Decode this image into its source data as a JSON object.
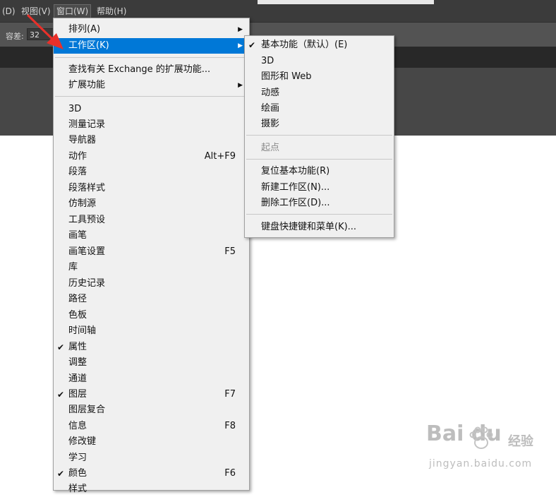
{
  "menubar": {
    "items": [
      {
        "label": "(D)",
        "active": false
      },
      {
        "label": "视图(V)",
        "active": false
      },
      {
        "label": "窗口(W)",
        "active": true
      },
      {
        "label": "帮助(H)",
        "active": false
      }
    ]
  },
  "options_bar": {
    "tolerance_label": "容差:",
    "tolerance_value": "32"
  },
  "window_menu": {
    "items": [
      {
        "label": "排列(A)",
        "submenu": true
      },
      {
        "label": "工作区(K)",
        "submenu": true,
        "highlighted": true
      },
      {
        "label": "查找有关 Exchange 的扩展功能..."
      },
      {
        "label": "扩展功能",
        "submenu": true
      },
      {
        "label": "3D"
      },
      {
        "label": "测量记录"
      },
      {
        "label": "导航器"
      },
      {
        "label": "动作",
        "shortcut": "Alt+F9"
      },
      {
        "label": "段落"
      },
      {
        "label": "段落样式"
      },
      {
        "label": "仿制源"
      },
      {
        "label": "工具预设"
      },
      {
        "label": "画笔"
      },
      {
        "label": "画笔设置",
        "shortcut": "F5"
      },
      {
        "label": "库"
      },
      {
        "label": "历史记录"
      },
      {
        "label": "路径"
      },
      {
        "label": "色板"
      },
      {
        "label": "时间轴"
      },
      {
        "label": "属性",
        "checked": true
      },
      {
        "label": "调整"
      },
      {
        "label": "通道"
      },
      {
        "label": "图层",
        "checked": true,
        "shortcut": "F7"
      },
      {
        "label": "图层复合"
      },
      {
        "label": "信息",
        "shortcut": "F8"
      },
      {
        "label": "修改键"
      },
      {
        "label": "学习"
      },
      {
        "label": "颜色",
        "checked": true,
        "shortcut": "F6"
      },
      {
        "label": "样式"
      }
    ]
  },
  "workspace_submenu": {
    "items": [
      {
        "label": "基本功能（默认）(E)",
        "checked": true
      },
      {
        "label": "3D"
      },
      {
        "label": "图形和 Web"
      },
      {
        "label": "动感"
      },
      {
        "label": "绘画"
      },
      {
        "label": "摄影"
      },
      {
        "label": "起点",
        "disabled": true
      },
      {
        "label": "复位基本功能(R)"
      },
      {
        "label": "新建工作区(N)..."
      },
      {
        "label": "删除工作区(D)..."
      },
      {
        "label": "键盘快捷键和菜单(K)..."
      }
    ]
  },
  "glyphs": {
    "check": "✔",
    "submenu_arrow": "▶"
  },
  "colors": {
    "highlight": "#0078d7",
    "menu_bg": "#f0f0f0",
    "annotation_arrow": "#e8302a",
    "app_dark": "#3b3b3b"
  },
  "watermark": {
    "logo": "Bai du",
    "brand": "经验",
    "url": "jingyan.baidu.com"
  }
}
